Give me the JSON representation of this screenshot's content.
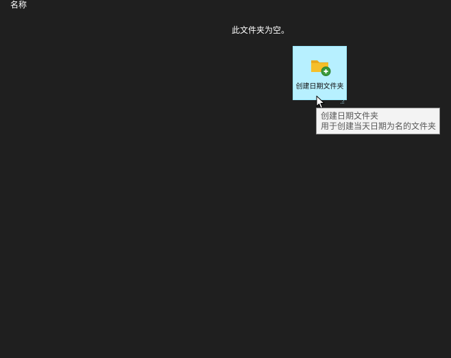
{
  "list_header": {
    "name_column": "名称"
  },
  "folder": {
    "empty_message": "此文件夹为空。"
  },
  "action_tile": {
    "label": "创建日期文件夹",
    "icon": "folder-add-icon",
    "state": "hovered",
    "background_color": "#b7f0ff",
    "folder_color": "#f5bf2a",
    "badge_color": "#3a9a3a"
  },
  "tooltip": {
    "title": "创建日期文件夹",
    "description": "用于创建当天日期为名的文件夹"
  },
  "cursor": {
    "icon": "arrow-cursor-icon"
  }
}
